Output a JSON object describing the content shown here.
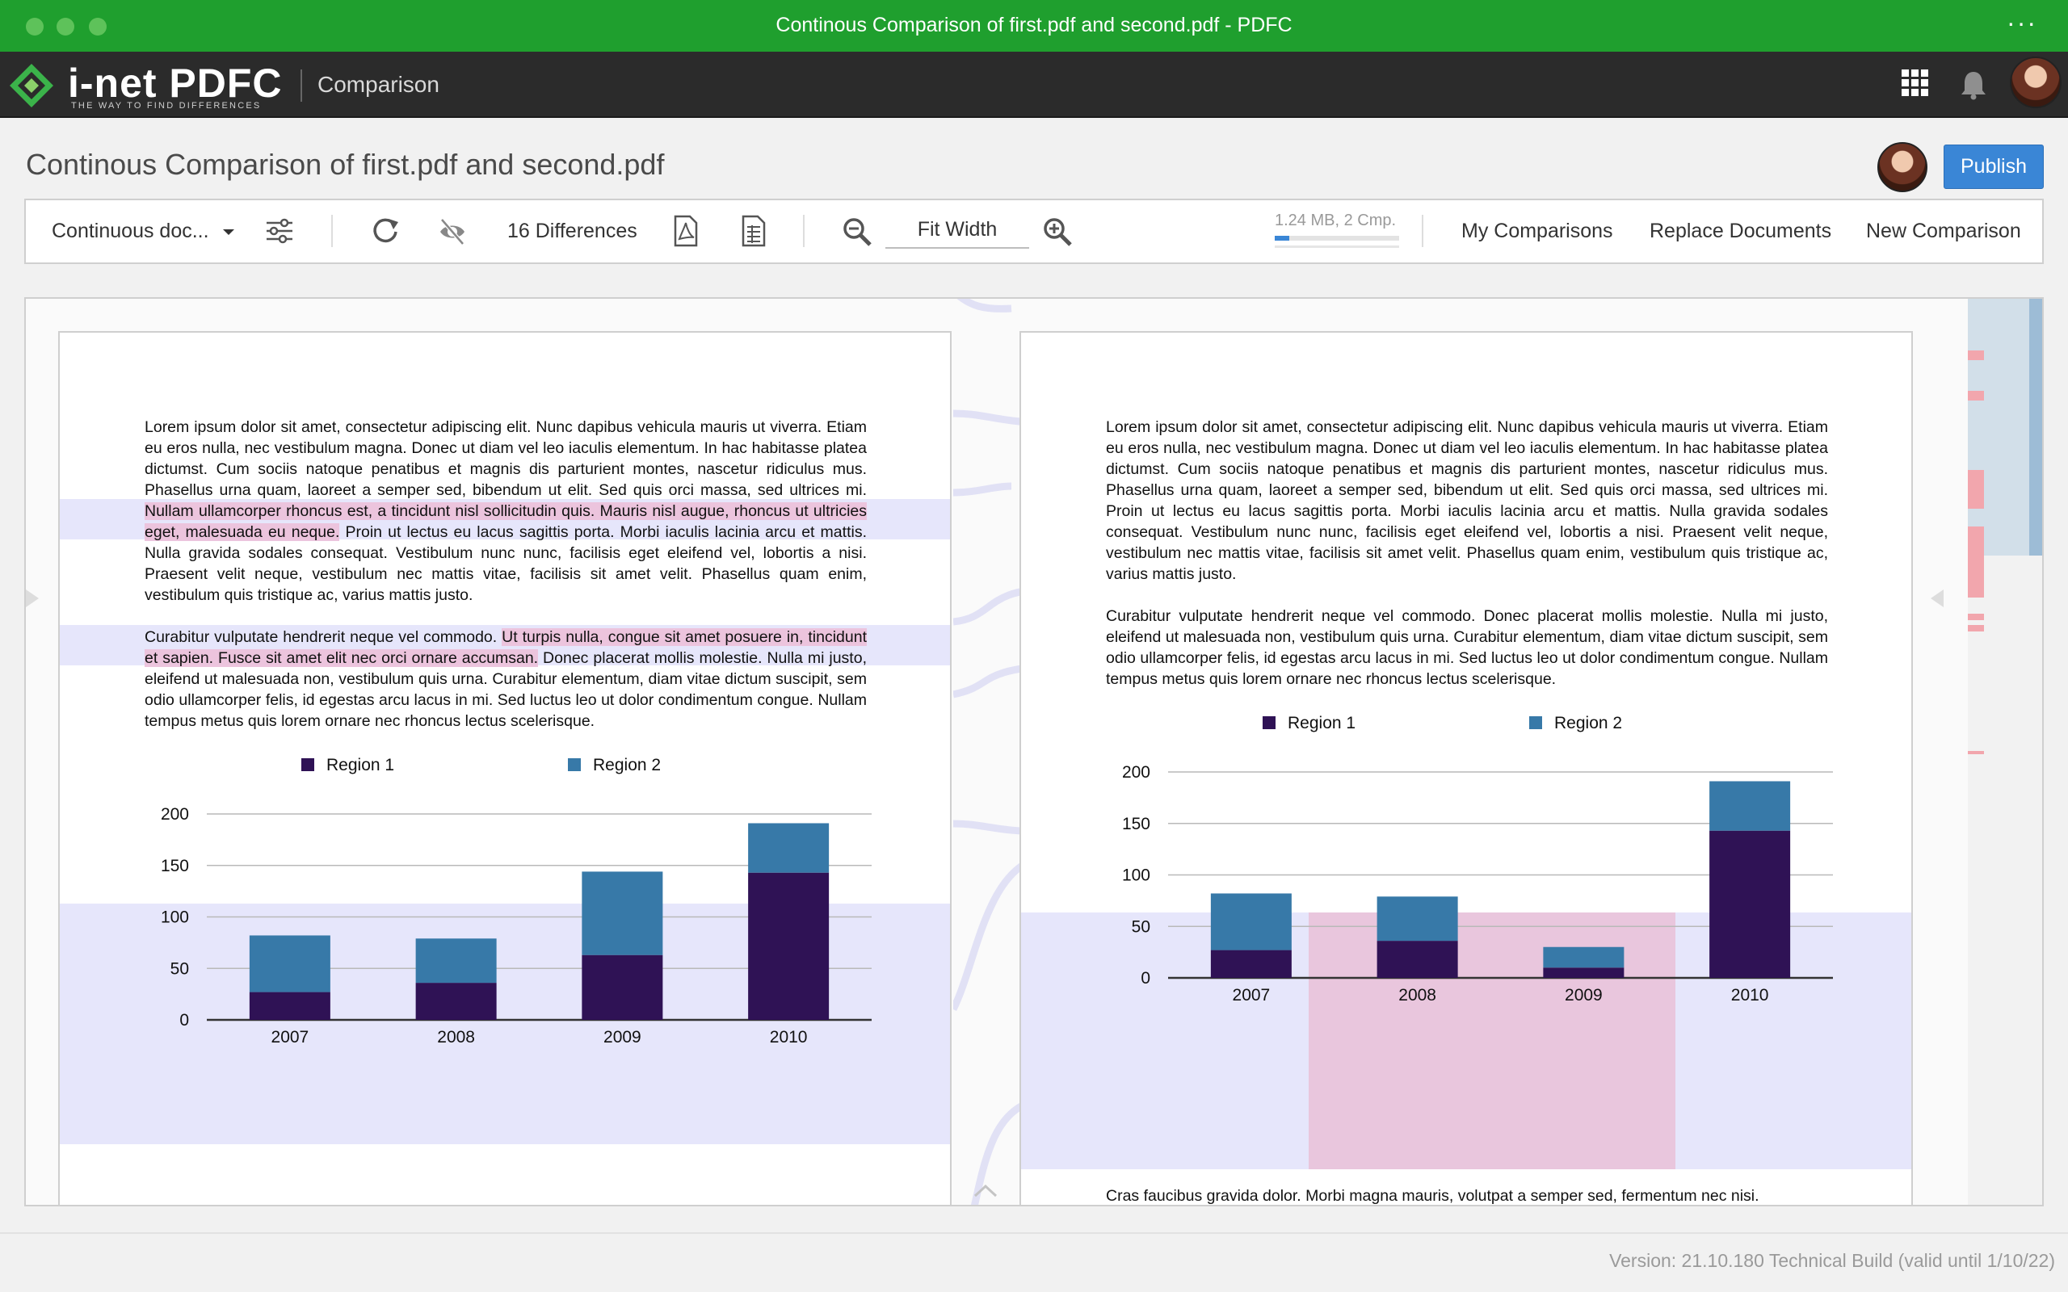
{
  "window": {
    "title": "Continous Comparison of first.pdf and second.pdf - PDFC",
    "more_label": "···"
  },
  "app": {
    "logo_text": "i-net PDFC",
    "logo_tagline": "THE WAY TO FIND DIFFERENCES",
    "section": "Comparison"
  },
  "header": {
    "title": "Continous Comparison of first.pdf and second.pdf",
    "publish_label": "Publish"
  },
  "toolbar": {
    "view_mode": "Continuous doc...",
    "differences": "16 Differences",
    "zoom_mode": "Fit Width",
    "memory_label": "1.24 MB, 2 Cmp.",
    "memory_fraction": 0.12,
    "my_comparisons": "My Comparisons",
    "replace_documents": "Replace Documents",
    "new_comparison": "New Comparison"
  },
  "left_doc": {
    "p1": {
      "before": "Lorem ipsum dolor sit amet, consectetur adipiscing elit. Nunc dapibus vehicula mauris ut viverra. Etiam eu eros nulla, nec vestibulum magna. Donec ut diam vel leo iaculis elementum. In hac habitasse platea dictumst. Cum sociis natoque penatibus et magnis dis parturient montes, nascetur ridiculus mus. Phasellus urna quam, laoreet a semper sed, bibendum ut elit. Sed quis orci massa, sed ultrices mi. ",
      "changed": "Nullam ullamcorper rhoncus est, a tincidunt nisl sollicitudin quis. Mauris nisl augue, rhoncus ut ultricies eget, malesuada eu neque.",
      "after": " Proin ut lectus eu lacus sagittis porta. Morbi iaculis lacinia arcu et mattis. Nulla gravida sodales consequat. Vestibulum nunc nunc, facilisis eget eleifend vel, lobortis a nisi. Praesent velit neque, vestibulum nec mattis vitae, facilisis sit amet velit. Phasellus quam enim, vestibulum quis tristique ac, varius mattis justo."
    },
    "p2": {
      "before": "Curabitur vulputate hendrerit neque vel commodo. ",
      "changed": "Ut turpis nulla, congue sit amet posuere in, tincidunt et sapien. Fusce sit amet elit nec orci ornare accumsan.",
      "after": " Donec placerat mollis molestie. Nulla mi justo, eleifend ut malesuada non, vestibulum quis urna. Curabitur elementum, diam vitae dictum suscipit, sem odio ullamcorper felis, id egestas arcu lacus in mi. Sed luctus leo ut dolor condimentum congue. Nullam tempus metus quis lorem ornare nec rhoncus lectus scelerisque."
    }
  },
  "right_doc": {
    "p1": "Lorem ipsum dolor sit amet, consectetur adipiscing elit. Nunc dapibus vehicula mauris ut viverra. Etiam eu eros nulla, nec vestibulum magna. Donec ut diam vel leo iaculis elementum. In hac habitasse platea dictumst. Cum sociis natoque penatibus et magnis dis parturient montes, nascetur ridiculus mus. Phasellus urna quam, laoreet a semper sed, bibendum ut elit. Sed quis orci massa, sed ultrices mi. Proin ut lectus eu lacus sagittis porta. Morbi iaculis lacinia arcu et mattis. Nulla gravida sodales consequat. Vestibulum nunc nunc, facilisis eget eleifend vel, lobortis a nisi. Praesent velit neque, vestibulum nec mattis vitae, facilisis sit amet velit. Phasellus quam enim, vestibulum quis tristique ac, varius mattis justo.",
    "p2": "Curabitur vulputate hendrerit neque vel commodo. Donec placerat mollis molestie. Nulla mi justo, eleifend ut malesuada non, vestibulum quis urna. Curabitur elementum, diam vitae dictum suscipit, sem odio ullamcorper felis, id egestas arcu lacus in mi. Sed luctus leo ut dolor condimentum congue. Nullam tempus metus quis lorem ornare nec rhoncus lectus scelerisque.",
    "p3": "Cras faucibus gravida dolor. Morbi magna mauris, volutpat a semper sed, fermentum nec nisi."
  },
  "chart_data": [
    {
      "type": "bar",
      "stacked": true,
      "categories": [
        "2007",
        "2008",
        "2009",
        "2010"
      ],
      "series": [
        {
          "name": "Region 1",
          "values": [
            27,
            36,
            63,
            143
          ],
          "color": "#2f1255"
        },
        {
          "name": "Region 2",
          "values": [
            55,
            43,
            81,
            48
          ],
          "color": "#3779a8"
        }
      ],
      "ylim": [
        0,
        200
      ],
      "yticks": [
        "0",
        "50",
        "100",
        "150",
        "200"
      ],
      "legend": "top",
      "grid": true
    },
    {
      "type": "bar",
      "stacked": true,
      "categories": [
        "2007",
        "2008",
        "2009",
        "2010"
      ],
      "series": [
        {
          "name": "Region 1",
          "values": [
            27,
            36,
            10,
            143
          ],
          "color": "#2f1255"
        },
        {
          "name": "Region 2",
          "values": [
            55,
            43,
            20,
            48
          ],
          "color": "#3779a8"
        }
      ],
      "ylim": [
        0,
        200
      ],
      "yticks": [
        "0",
        "50",
        "100",
        "150",
        "200"
      ],
      "legend": "top",
      "grid": true
    }
  ],
  "footer": {
    "version": "Version: 21.10.180 Technical Build (valid until 1/10/22)"
  },
  "colors": {
    "titlebar": "#1f9f2e",
    "appbar": "#2b2b2b",
    "accent": "#3a86d6",
    "diff_change": "#ecc4dd",
    "diff_block": "#e6e6fb"
  }
}
